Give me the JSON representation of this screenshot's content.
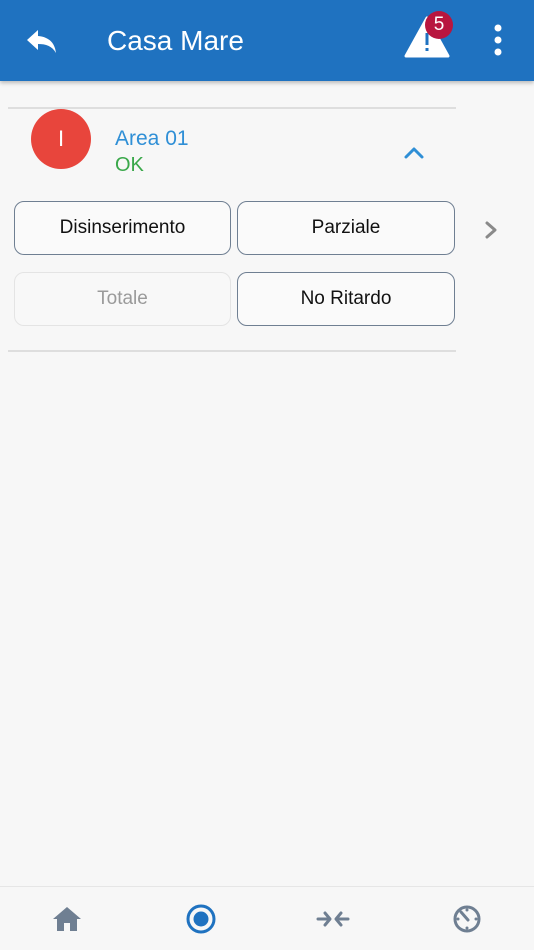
{
  "header": {
    "title": "Casa Mare",
    "alert_count": "5"
  },
  "area": {
    "avatar_letter": "I",
    "name": "Area 01",
    "status": "OK"
  },
  "actions": [
    {
      "label": "Disinserimento",
      "enabled": true
    },
    {
      "label": "Parziale",
      "enabled": true
    },
    {
      "label": "Totale",
      "enabled": false
    },
    {
      "label": "No Ritardo",
      "enabled": true
    }
  ],
  "bottom_nav": {
    "items": [
      "home-icon",
      "arm-status-icon",
      "exchange-icon",
      "timer-icon"
    ],
    "active_index": 1
  },
  "colors": {
    "primary": "#1f72c0",
    "badge": "#b8163f",
    "avatar": "#e8453c",
    "area_name": "#2f8fd6",
    "status_ok": "#3aa84a",
    "nav_icon": "#6f7f92"
  }
}
